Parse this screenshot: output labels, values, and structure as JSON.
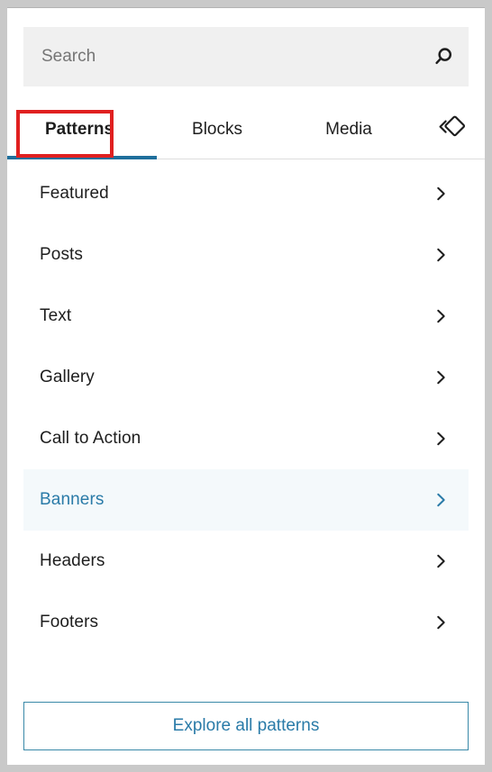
{
  "search": {
    "placeholder": "Search",
    "value": "",
    "icon": "search-icon"
  },
  "tabs": {
    "items": [
      {
        "label": "Patterns",
        "selected": true
      },
      {
        "label": "Blocks",
        "selected": false
      },
      {
        "label": "Media",
        "selected": false
      }
    ],
    "trailing_icon": "block-diamond-icon",
    "indicator_color": "#1f6f9c"
  },
  "categories": {
    "items": [
      {
        "label": "Featured",
        "chevron": "chevron-right-icon",
        "active": false
      },
      {
        "label": "Posts",
        "chevron": "chevron-right-icon",
        "active": false
      },
      {
        "label": "Text",
        "chevron": "chevron-right-icon",
        "active": false
      },
      {
        "label": "Gallery",
        "chevron": "chevron-right-icon",
        "active": false
      },
      {
        "label": "Call to Action",
        "chevron": "chevron-right-icon",
        "active": false
      },
      {
        "label": "Banners",
        "chevron": "chevron-right-icon",
        "active": true
      },
      {
        "label": "Headers",
        "chevron": "chevron-right-icon",
        "active": false
      },
      {
        "label": "Footers",
        "chevron": "chevron-right-icon",
        "active": false
      }
    ],
    "active_bg": "#f4f9fb",
    "active_color": "#2a7ba8"
  },
  "footer": {
    "explore_label": "Explore all patterns",
    "accent_color": "#2a7ba8"
  },
  "annotation": {
    "target": "Patterns",
    "color": "#e02020"
  }
}
